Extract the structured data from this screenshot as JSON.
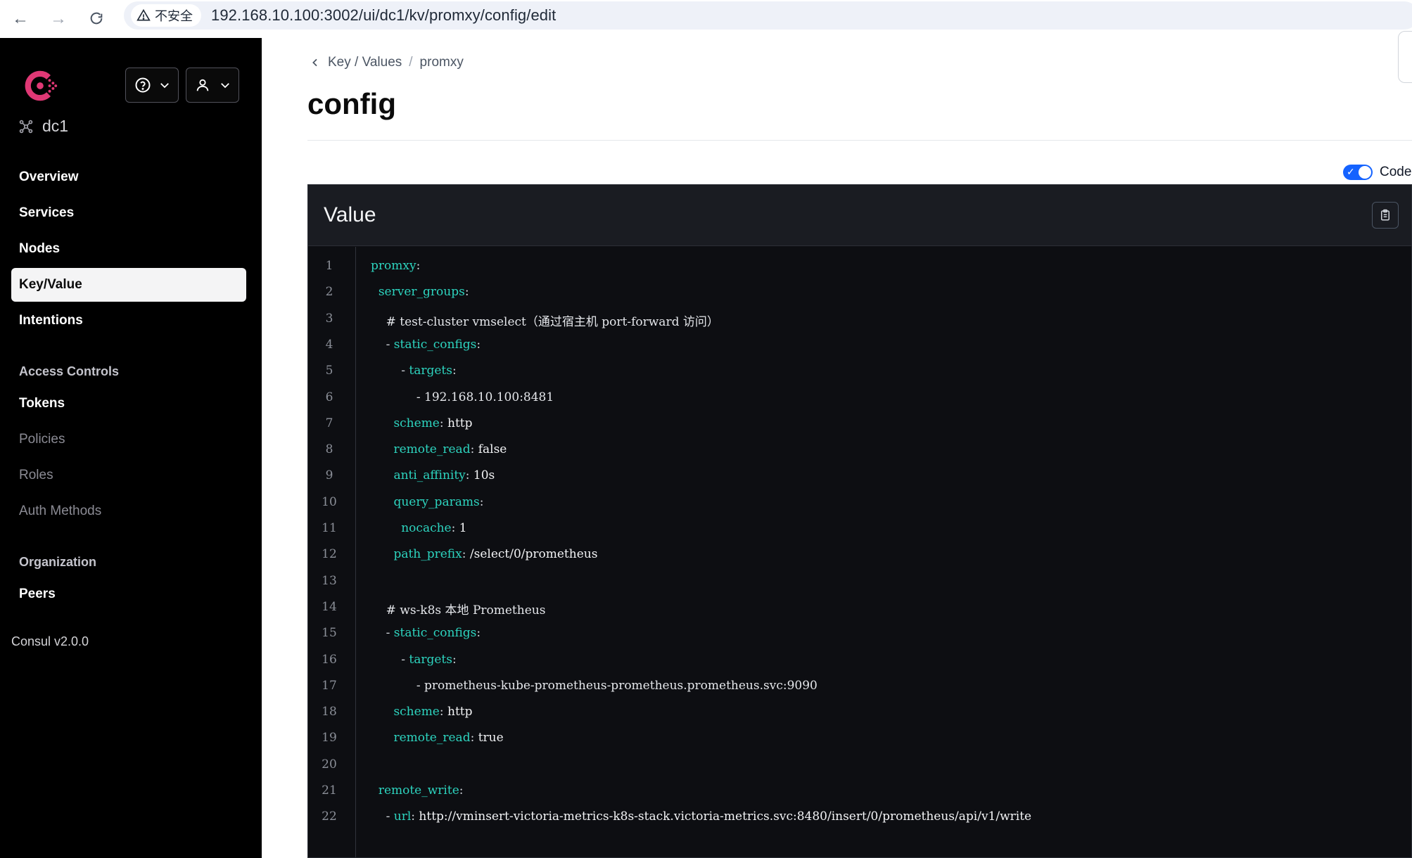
{
  "browser": {
    "security_label": "不安全",
    "url": "192.168.10.100:3002/ui/dc1/kv/promxy/config/edit"
  },
  "sidebar": {
    "datacenter": "dc1",
    "nav": [
      {
        "label": "Overview",
        "active": false
      },
      {
        "label": "Services",
        "active": false
      },
      {
        "label": "Nodes",
        "active": false
      },
      {
        "label": "Key/Value",
        "active": true
      },
      {
        "label": "Intentions",
        "active": false
      }
    ],
    "access_controls": {
      "title": "Access Controls",
      "items": [
        "Tokens",
        "Policies",
        "Roles",
        "Auth Methods"
      ]
    },
    "organization": {
      "title": "Organization",
      "items": [
        "Peers"
      ]
    },
    "version": "Consul v2.0.0"
  },
  "main": {
    "breadcrumb": {
      "parent": "Key / Values",
      "sep": "/",
      "current": "promxy"
    },
    "title": "config",
    "code_toggle_label": "Code",
    "editor_title": "Value"
  },
  "code": [
    {
      "n": "1",
      "indent": "",
      "key": "promxy",
      "punc": ":",
      "val": ""
    },
    {
      "n": "2",
      "indent": "  ",
      "key": "server_groups",
      "punc": ":",
      "val": ""
    },
    {
      "n": "3",
      "indent": "    ",
      "comment": "# test-cluster vmselect（通过宿主机 port-forward 访问）"
    },
    {
      "n": "4",
      "indent": "    - ",
      "key": "static_configs",
      "punc": ":",
      "val": ""
    },
    {
      "n": "5",
      "indent": "        - ",
      "key": "targets",
      "punc": ":",
      "val": ""
    },
    {
      "n": "6",
      "indent": "            ",
      "comment": "- 192.168.10.100:8481"
    },
    {
      "n": "7",
      "indent": "      ",
      "key": "scheme",
      "punc": ": ",
      "val": "http"
    },
    {
      "n": "8",
      "indent": "      ",
      "key": "remote_read",
      "punc": ": ",
      "val": "false"
    },
    {
      "n": "9",
      "indent": "      ",
      "key": "anti_affinity",
      "punc": ": ",
      "val": "10s"
    },
    {
      "n": "10",
      "indent": "      ",
      "key": "query_params",
      "punc": ":",
      "val": ""
    },
    {
      "n": "11",
      "indent": "        ",
      "key": "nocache",
      "punc": ": ",
      "val": "1"
    },
    {
      "n": "12",
      "indent": "      ",
      "key": "path_prefix",
      "punc": ": ",
      "val": "/select/0/prometheus"
    },
    {
      "n": "13",
      "indent": "",
      "comment": ""
    },
    {
      "n": "14",
      "indent": "    ",
      "comment": "# ws-k8s 本地 Prometheus"
    },
    {
      "n": "15",
      "indent": "    - ",
      "key": "static_configs",
      "punc": ":",
      "val": ""
    },
    {
      "n": "16",
      "indent": "        - ",
      "key": "targets",
      "punc": ":",
      "val": ""
    },
    {
      "n": "17",
      "indent": "            ",
      "comment": "- prometheus-kube-prometheus-prometheus.prometheus.svc:9090"
    },
    {
      "n": "18",
      "indent": "      ",
      "key": "scheme",
      "punc": ": ",
      "val": "http"
    },
    {
      "n": "19",
      "indent": "      ",
      "key": "remote_read",
      "punc": ": ",
      "val": "true"
    },
    {
      "n": "20",
      "indent": "",
      "comment": ""
    },
    {
      "n": "21",
      "indent": "  ",
      "key": "remote_write",
      "punc": ":",
      "val": ""
    },
    {
      "n": "22",
      "indent": "    - ",
      "key": "url",
      "punc": ": ",
      "val": "http://vminsert-victoria-metrics-k8s-stack.victoria-metrics.svc:8480/insert/0/prometheus/api/v1/write"
    }
  ],
  "colors": {
    "accent": "#1563ff",
    "consul_brand": "#e03875",
    "code_key": "#2dd4bf"
  }
}
